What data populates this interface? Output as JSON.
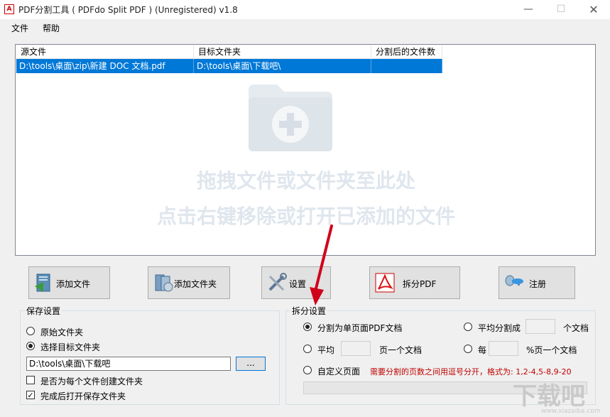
{
  "window": {
    "title": "PDF分割工具 ( PDFdo Split PDF ) (Unregistered) v1.8",
    "app_icon_text": "A",
    "minimize": "—",
    "maximize": "☐",
    "close": "✕"
  },
  "menu": {
    "file": "文件",
    "help": "帮助"
  },
  "file_list": {
    "columns": [
      "源文件",
      "目标文件夹",
      "分割后的文件数"
    ],
    "rows": [
      {
        "source": "D:\\tools\\桌面\\zip\\新建 DOC 文档.pdf",
        "target": "D:\\tools\\桌面\\下载吧\\",
        "count": ""
      }
    ],
    "drop_hint_1": "拖拽文件或文件夹至此处",
    "drop_hint_2": "点击右键移除或打开已添加的文件"
  },
  "toolbar": {
    "add_file": "添加文件",
    "add_folder": "添加文件夹",
    "settings": "设置",
    "split_pdf": "拆分PDF",
    "register": "注册"
  },
  "save_settings": {
    "title": "保存设置",
    "original_folder": "原始文件夹",
    "choose_target": "选择目标文件夹",
    "path_value": "D:\\tools\\桌面\\下载吧",
    "browse": "...",
    "create_per_file": "是否为每个文件创建文件夹",
    "open_after": "完成后打开保存文件夹"
  },
  "split_settings": {
    "title": "拆分设置",
    "single_page": "分割为单页面PDF文档",
    "even_split": "平均分割成",
    "even_split_suffix": "个文档",
    "average": "平均",
    "average_suffix": "页一个文档",
    "every": "每",
    "every_suffix": "%页一个文档",
    "custom_pages": "自定义页面",
    "custom_hint": "需要分割的页数之间用逗号分开，格式为: 1,2-4,5-8,9-20"
  },
  "watermark": {
    "text": "下载吧",
    "url": "www.xiazaiba.com"
  },
  "colors": {
    "selection": "#0078d7",
    "hint_red": "#c00000",
    "arrow": "#d0021b"
  }
}
